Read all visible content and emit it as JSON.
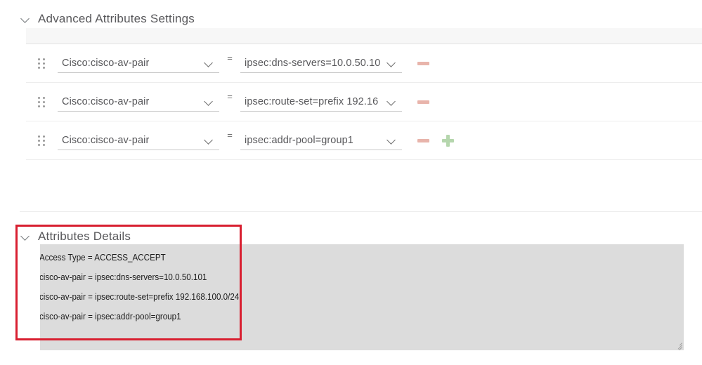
{
  "advanced_section": {
    "title": "Advanced Attributes Settings",
    "chevron_icon": "chevron-down-icon",
    "rows": [
      {
        "drag_handle_icon": "drag-handle-icon",
        "name": "Cisco:cisco-av-pair",
        "equals": "=",
        "value": "ipsec:dns-servers=10.0.50.10",
        "caret_icon": "chevron-down-icon",
        "minus_label": "remove-attribute",
        "plus_label": ""
      },
      {
        "drag_handle_icon": "drag-handle-icon",
        "name": "Cisco:cisco-av-pair",
        "equals": "=",
        "value": "ipsec:route-set=prefix 192.16",
        "caret_icon": "chevron-down-icon",
        "minus_label": "remove-attribute",
        "plus_label": ""
      },
      {
        "drag_handle_icon": "drag-handle-icon",
        "name": "Cisco:cisco-av-pair",
        "equals": "=",
        "value": "ipsec:addr-pool=group1",
        "caret_icon": "chevron-down-icon",
        "minus_label": "remove-attribute",
        "plus_label": "add-attribute"
      }
    ]
  },
  "details_section": {
    "title": "Attributes Details",
    "chevron_icon": "chevron-down-icon",
    "lines": [
      "Access Type = ACCESS_ACCEPT",
      "cisco-av-pair = ipsec:dns-servers=10.0.50.101",
      "cisco-av-pair = ipsec:route-set=prefix 192.168.100.0/24",
      "cisco-av-pair = ipsec:addr-pool=group1"
    ]
  },
  "colors": {
    "highlight_border": "#d81f30",
    "minus_icon": "#e8b4ab",
    "plus_icon": "#b5d6ad",
    "details_bg": "#dcdcdc"
  }
}
